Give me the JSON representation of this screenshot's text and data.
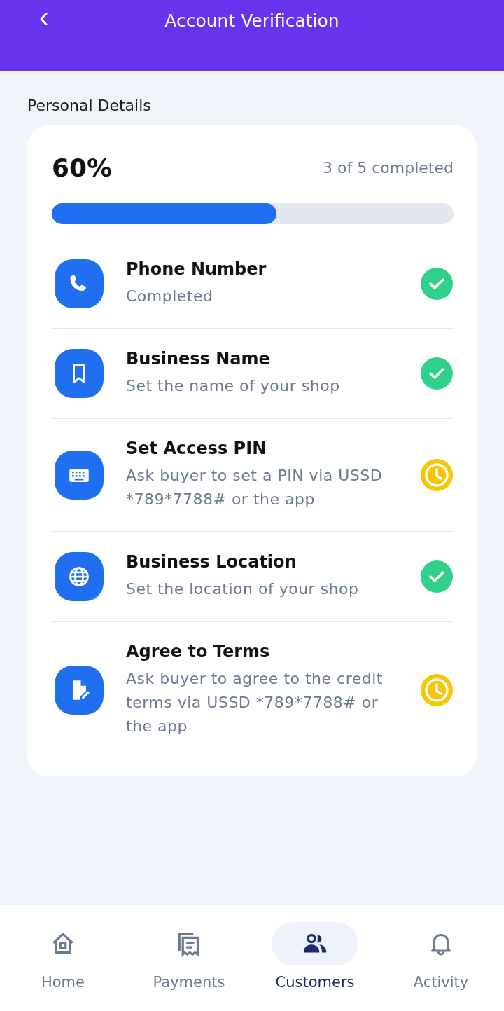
{
  "header": {
    "back_icon": "‹",
    "title": "Account Verification"
  },
  "section_title": "Personal Details",
  "progress": {
    "percent": "60%",
    "summary": "3 of 5 completed",
    "level": 0.56
  },
  "steps": [
    {
      "title": "Phone Number",
      "subtitle": "Completed",
      "completed": true
    },
    {
      "title": "Business Name",
      "subtitle": "Set the name of your shop",
      "completed": true
    },
    {
      "title": "Set Access PIN",
      "subtitle": "Ask buyer to set a PIN via USSD *789*7788# or the app",
      "completed": false
    },
    {
      "title": "Business Location",
      "subtitle": "Set the location of your shop",
      "completed": true
    },
    {
      "title": "Agree to Terms",
      "subtitle": "Ask buyer to agree to the credit terms via USSD *789*7788# or the app",
      "completed": false
    }
  ],
  "nav": [
    {
      "label": "Home",
      "selected": false
    },
    {
      "label": "Payments",
      "selected": false
    },
    {
      "label": "Customers",
      "selected": true
    },
    {
      "label": "Activity",
      "selected": false
    }
  ]
}
